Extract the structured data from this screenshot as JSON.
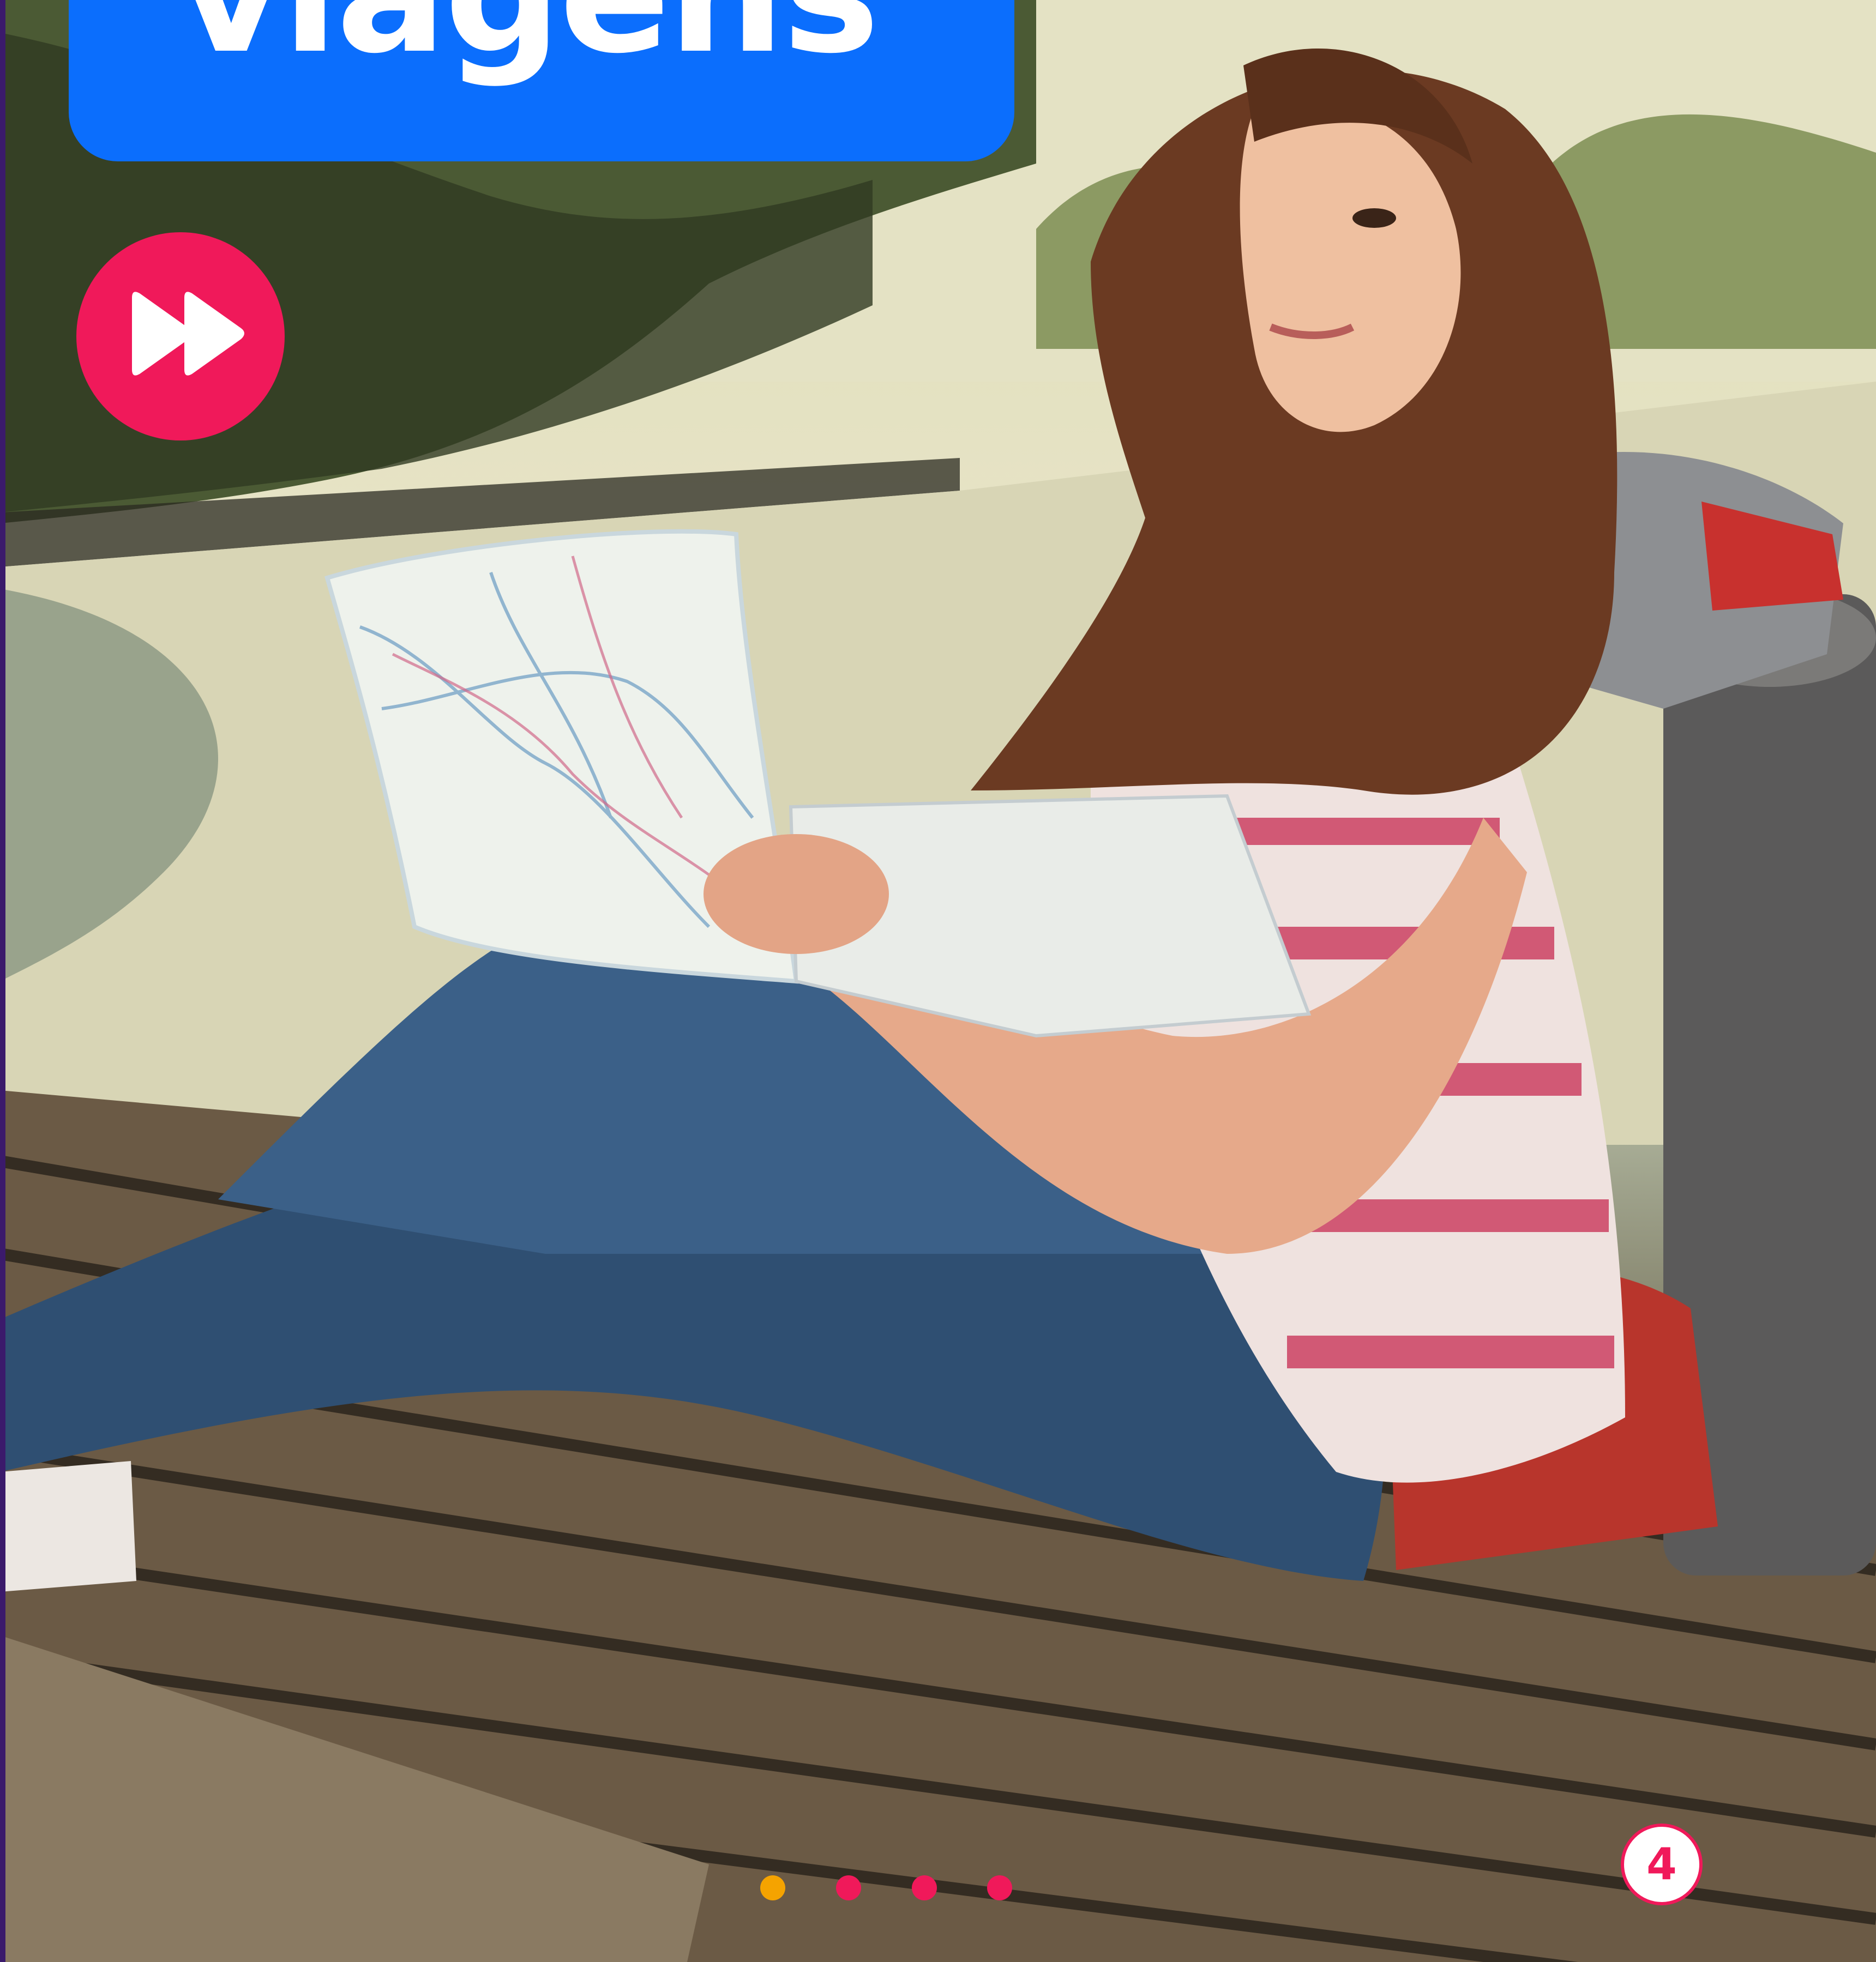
{
  "header": {
    "title": "viagens"
  },
  "controls": {
    "fast_forward_icon": "fast-forward-icon"
  },
  "pagination": {
    "total": 4,
    "active_index": 0,
    "dot_colors": [
      "#f5a300",
      "#f0195a",
      "#f0195a",
      "#f0195a"
    ]
  },
  "page_number": "4",
  "colors": {
    "banner": "#0b6efd",
    "accent": "#f0195a",
    "active_dot": "#f5a300",
    "sidebar_edge": "#3b1a6b"
  },
  "image": {
    "subject": "traveler-with-map-and-backpack"
  }
}
